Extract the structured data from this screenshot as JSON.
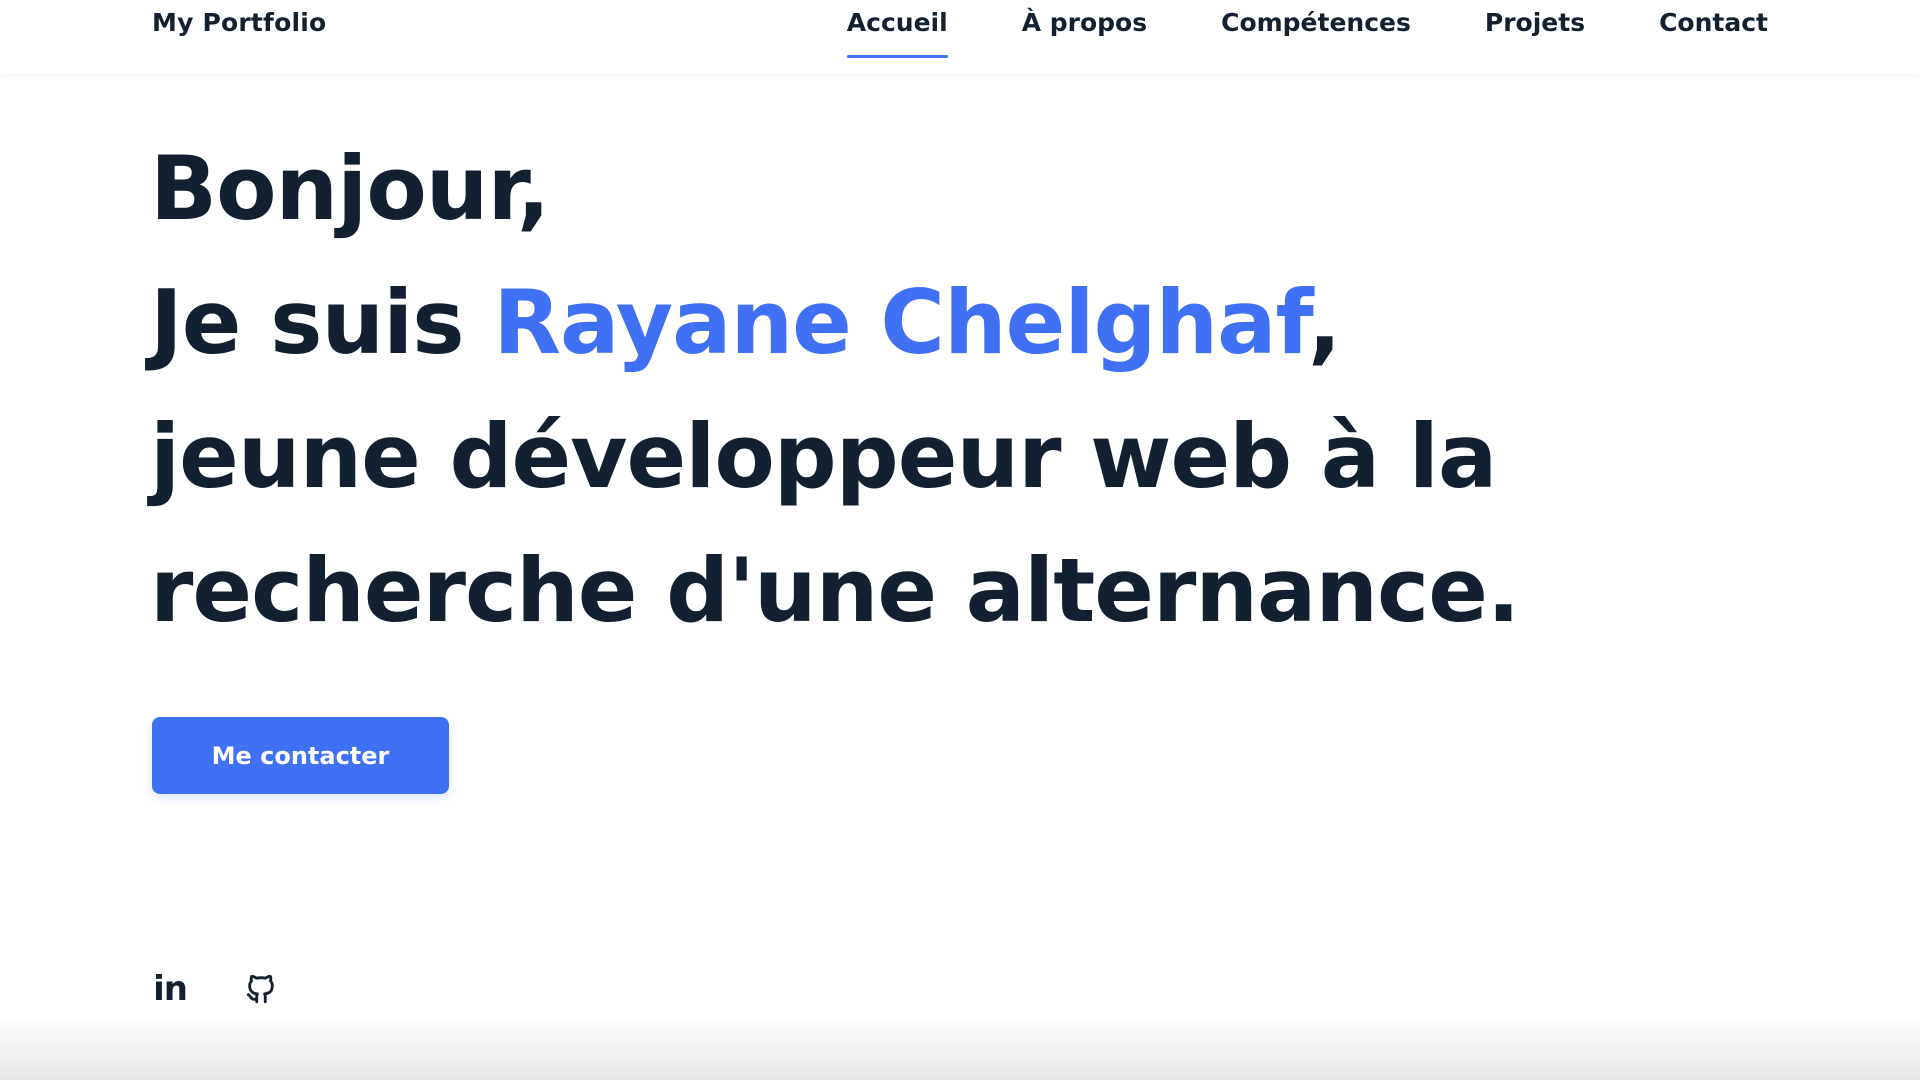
{
  "header": {
    "brand": "My Portfolio",
    "nav": [
      {
        "label": "Accueil",
        "active": true
      },
      {
        "label": "À propos",
        "active": false
      },
      {
        "label": "Compétences",
        "active": false
      },
      {
        "label": "Projets",
        "active": false
      },
      {
        "label": "Contact",
        "active": false
      }
    ]
  },
  "hero": {
    "line1": "Bonjour,",
    "line2_prefix": "Je suis ",
    "name": "Rayane Chelghaf",
    "line2_suffix": ",",
    "line3": "jeune développeur web à la",
    "line4": "recherche d'une alternance.",
    "cta_label": "Me contacter"
  },
  "social": {
    "linkedin_label": "in",
    "icons": [
      "linkedin-icon",
      "github-icon"
    ]
  },
  "colors": {
    "accent": "#4070f4",
    "text": "#13202f",
    "background": "#ffffff"
  }
}
